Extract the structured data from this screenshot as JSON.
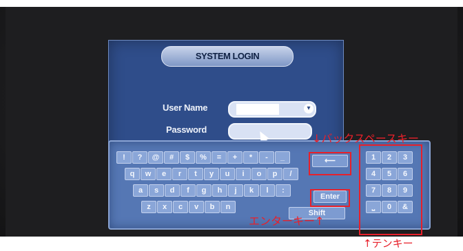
{
  "dialog": {
    "title": "SYSTEM LOGIN",
    "username_label": "User Name",
    "password_label": "Password"
  },
  "keyboard": {
    "row1": [
      "!",
      "?",
      "@",
      "#",
      "$",
      "%",
      "=",
      "+",
      "*",
      "-",
      "_"
    ],
    "row2": [
      "q",
      "w",
      "e",
      "r",
      "t",
      "y",
      "u",
      "i",
      "o",
      "p",
      "/"
    ],
    "row3": [
      "a",
      "s",
      "d",
      "f",
      "g",
      "h",
      "j",
      "k",
      "l",
      ":"
    ],
    "row4": [
      "z",
      "x",
      "c",
      "v",
      "b",
      "n"
    ],
    "backspace_symbol": "⟵",
    "enter_label": "Enter",
    "shift_label": "Shift",
    "numpad": [
      "1",
      "2",
      "3",
      "4",
      "5",
      "6",
      "7",
      "8",
      "9",
      "⎵",
      "0",
      "&"
    ]
  },
  "annotations": {
    "backspace": "↓バックスペースキー",
    "enter": "エンターキー↑",
    "numpad": "↑テンキー"
  },
  "colors": {
    "annotation": "#e8202a",
    "dialog_bg": "#2f4d8a",
    "keyboard_bg": "#5577b4"
  }
}
